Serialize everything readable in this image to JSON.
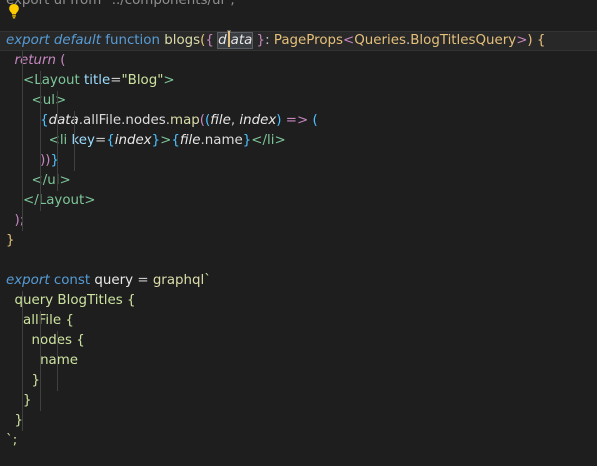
{
  "editor": {
    "lines": [
      [
        {
          "t": "export ",
          "c": "c-faded"
        },
        {
          "t": "ui ",
          "c": "c-faded"
        },
        {
          "t": "from ",
          "c": "c-faded"
        },
        {
          "t": "\"../components/ui\";",
          "c": "c-faded"
        }
      ],
      [],
      [
        {
          "t": "export ",
          "c": "c-kw-italic"
        },
        {
          "t": "default ",
          "c": "c-kw-italic"
        },
        {
          "t": "function ",
          "c": "c-kw"
        },
        {
          "t": "blogs",
          "c": "c-fn"
        },
        {
          "t": "(",
          "c": "c-bracket-y"
        },
        {
          "t": "{ ",
          "c": "c-bracket-p"
        },
        {
          "t": "data",
          "c": "c-param",
          "sel": true,
          "cursor": true
        },
        {
          "t": " }",
          "c": "c-bracket-p"
        },
        {
          "t": ": ",
          "c": "c-punct"
        },
        {
          "t": "PageProps",
          "c": "c-type"
        },
        {
          "t": "<",
          "c": "c-bracket-p"
        },
        {
          "t": "Queries",
          "c": "c-type"
        },
        {
          "t": ".",
          "c": "c-punct"
        },
        {
          "t": "BlogTitlesQuery",
          "c": "c-type"
        },
        {
          "t": ">",
          "c": "c-bracket-p"
        },
        {
          "t": ") ",
          "c": "c-bracket-y"
        },
        {
          "t": "{",
          "c": "c-bracket-y"
        }
      ],
      [
        {
          "t": "  "
        },
        {
          "t": "return ",
          "c": "c-kw-ctrl"
        },
        {
          "t": "(",
          "c": "c-bracket-p"
        }
      ],
      [
        {
          "t": "    "
        },
        {
          "t": "<",
          "c": "c-tag"
        },
        {
          "t": "Layout ",
          "c": "c-tag"
        },
        {
          "t": "title",
          "c": "c-attr"
        },
        {
          "t": "=",
          "c": "c-punct"
        },
        {
          "t": "\"Blog\"",
          "c": "c-str"
        },
        {
          "t": ">",
          "c": "c-tag"
        }
      ],
      [
        {
          "t": "      "
        },
        {
          "t": "<",
          "c": "c-tag"
        },
        {
          "t": "ul",
          "c": "c-tag"
        },
        {
          "t": ">",
          "c": "c-tag"
        }
      ],
      [
        {
          "t": "        "
        },
        {
          "t": "{",
          "c": "c-bracket-b"
        },
        {
          "t": "data",
          "c": "c-param"
        },
        {
          "t": ".",
          "c": "c-punct"
        },
        {
          "t": "allFile",
          "c": "c-prop"
        },
        {
          "t": ".",
          "c": "c-punct"
        },
        {
          "t": "nodes",
          "c": "c-prop"
        },
        {
          "t": ".",
          "c": "c-punct"
        },
        {
          "t": "map",
          "c": "c-method"
        },
        {
          "t": "(",
          "c": "c-bracket-p"
        },
        {
          "t": "(",
          "c": "c-bracket-b"
        },
        {
          "t": "file",
          "c": "c-param"
        },
        {
          "t": ", ",
          "c": "c-punct"
        },
        {
          "t": "index",
          "c": "c-param"
        },
        {
          "t": ") ",
          "c": "c-bracket-b"
        },
        {
          "t": "=> ",
          "c": "c-arrow"
        },
        {
          "t": "(",
          "c": "c-bracket-b"
        }
      ],
      [
        {
          "t": "          "
        },
        {
          "t": "<",
          "c": "c-tag"
        },
        {
          "t": "li ",
          "c": "c-tag"
        },
        {
          "t": "key",
          "c": "c-attr"
        },
        {
          "t": "=",
          "c": "c-punct"
        },
        {
          "t": "{",
          "c": "c-bracket-b"
        },
        {
          "t": "index",
          "c": "c-param"
        },
        {
          "t": "}",
          "c": "c-bracket-b"
        },
        {
          "t": ">",
          "c": "c-tag"
        },
        {
          "t": "{",
          "c": "c-bracket-b"
        },
        {
          "t": "file",
          "c": "c-param"
        },
        {
          "t": ".",
          "c": "c-punct"
        },
        {
          "t": "name",
          "c": "c-prop"
        },
        {
          "t": "}",
          "c": "c-bracket-b"
        },
        {
          "t": "</",
          "c": "c-tag"
        },
        {
          "t": "li",
          "c": "c-tag"
        },
        {
          "t": ">",
          "c": "c-tag"
        }
      ],
      [
        {
          "t": "        "
        },
        {
          "t": "))",
          "c": "c-bracket-p"
        },
        {
          "t": "}",
          "c": "c-bracket-b"
        }
      ],
      [
        {
          "t": "      "
        },
        {
          "t": "</",
          "c": "c-tag"
        },
        {
          "t": "ul",
          "c": "c-tag"
        },
        {
          "t": ">",
          "c": "c-tag"
        }
      ],
      [
        {
          "t": "    "
        },
        {
          "t": "</",
          "c": "c-tag"
        },
        {
          "t": "Layout",
          "c": "c-tag"
        },
        {
          "t": ">",
          "c": "c-tag"
        }
      ],
      [
        {
          "t": "  "
        },
        {
          "t": ");",
          "c": "c-bracket-p"
        }
      ],
      [
        {
          "t": "}",
          "c": "c-bracket-y"
        }
      ],
      [],
      [
        {
          "t": "export ",
          "c": "c-kw-italic"
        },
        {
          "t": "const ",
          "c": "c-kw"
        },
        {
          "t": "query ",
          "c": "c-var"
        },
        {
          "t": "= ",
          "c": "c-punct"
        },
        {
          "t": "graphql",
          "c": "c-fn"
        },
        {
          "t": "`",
          "c": "c-gqlbt"
        }
      ],
      [
        {
          "t": "  "
        },
        {
          "t": "query BlogTitles {",
          "c": "c-gql"
        }
      ],
      [
        {
          "t": "    "
        },
        {
          "t": "allFile {",
          "c": "c-gql"
        }
      ],
      [
        {
          "t": "      "
        },
        {
          "t": "nodes {",
          "c": "c-gql"
        }
      ],
      [
        {
          "t": "        "
        },
        {
          "t": "name",
          "c": "c-gql"
        }
      ],
      [
        {
          "t": "      "
        },
        {
          "t": "}",
          "c": "c-gql"
        }
      ],
      [
        {
          "t": "    "
        },
        {
          "t": "}",
          "c": "c-gql"
        }
      ],
      [
        {
          "t": "  "
        },
        {
          "t": "}",
          "c": "c-gql"
        }
      ],
      [
        {
          "t": "`;",
          "c": "c-gqlbt"
        }
      ]
    ]
  },
  "icons": {
    "lightbulb": "lightbulb-icon"
  },
  "colors": {
    "background": "#1e1e1e",
    "current_line": "#282828",
    "lightbulb": "#ffcc00"
  }
}
